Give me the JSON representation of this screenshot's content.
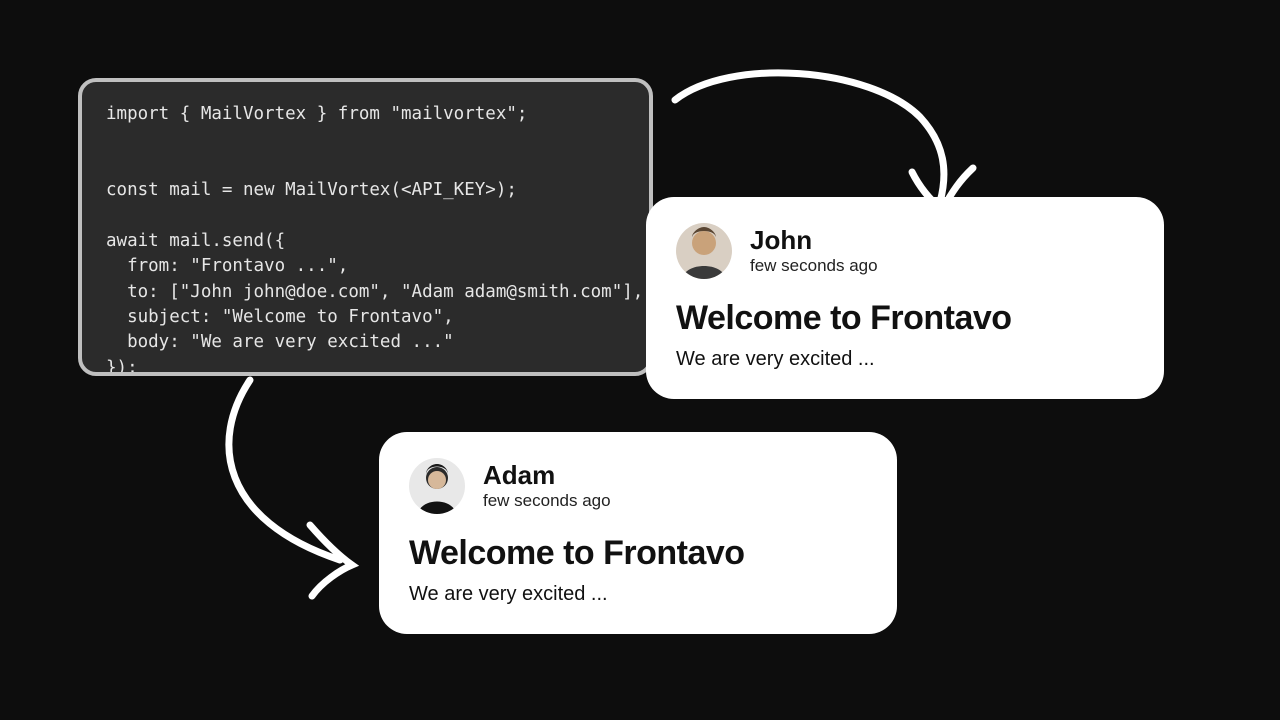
{
  "code": "import { MailVortex } from \"mailvortex\";\n\n\nconst mail = new MailVortex(<API_KEY>);\n\nawait mail.send({\n  from: \"Frontavo ...\",\n  to: [\"John john@doe.com\", \"Adam adam@smith.com\"],\n  subject: \"Welcome to Frontavo\",\n  body: \"We are very excited ...\"\n});",
  "cards": {
    "john": {
      "name": "John",
      "time": "few seconds ago",
      "title": "Welcome to Frontavo",
      "body": "We are very excited ..."
    },
    "adam": {
      "name": "Adam",
      "time": "few seconds ago",
      "title": "Welcome to Frontavo",
      "body": "We are very excited ..."
    }
  }
}
